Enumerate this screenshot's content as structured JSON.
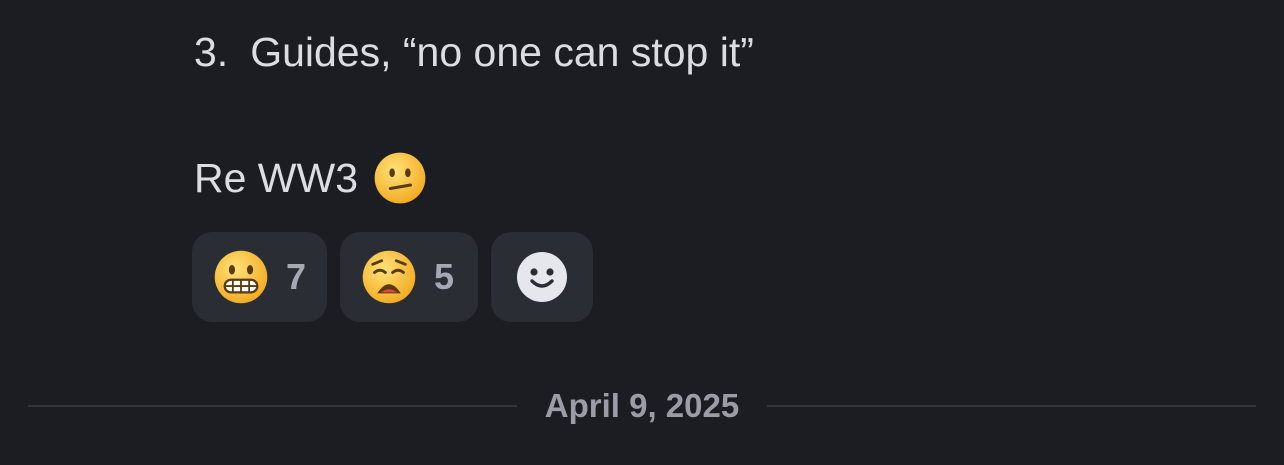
{
  "message": {
    "list_item_number": "3.",
    "list_item_text": "Guides, “no one can stop it”",
    "line2_text": "Re WW3",
    "line2_emoji": "confused-face-emoji"
  },
  "reactions": [
    {
      "emoji": "grimacing-face-emoji",
      "count": "7"
    },
    {
      "emoji": "weary-face-emoji",
      "count": "5"
    }
  ],
  "add_reaction": {
    "icon": "smiley-add-reaction-icon"
  },
  "date_divider": {
    "label": "April 9, 2025"
  },
  "colors": {
    "background": "#1c1d22",
    "text": "#dcdde2",
    "reaction_bg": "#2b2d35",
    "muted": "#9a9ca6",
    "emoji_yellow": "#f7c23a"
  }
}
